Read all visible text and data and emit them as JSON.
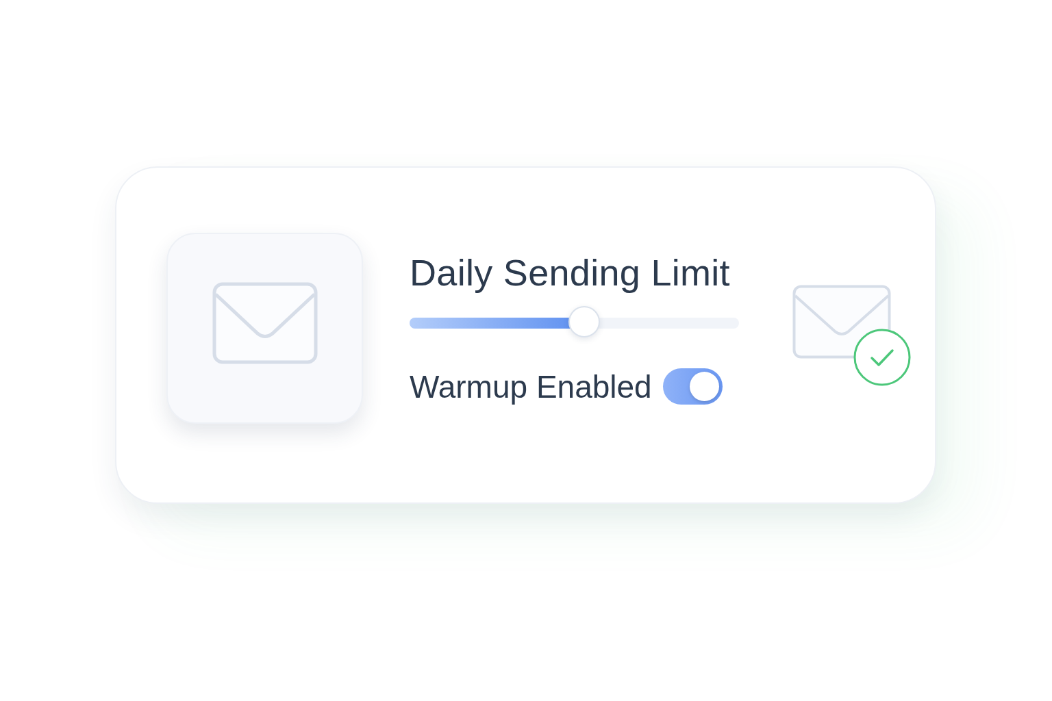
{
  "title": "Daily Sending Limit",
  "slider": {
    "level": 0.53
  },
  "warmup": {
    "label": "Warmup Enabled",
    "on": true
  }
}
